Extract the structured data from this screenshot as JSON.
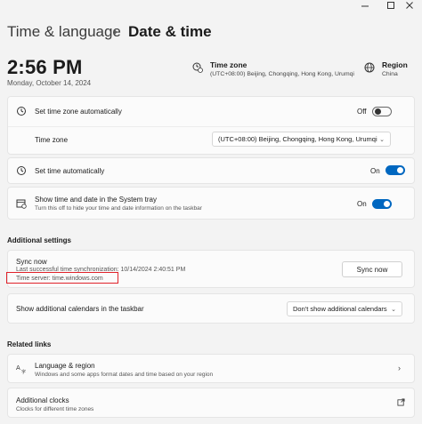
{
  "header": {
    "parent": "Time & language",
    "separator": "›",
    "title": "Date & time"
  },
  "clock": {
    "time": "2:56 PM",
    "date": "Monday, October 14, 2024"
  },
  "timezone_info": {
    "title": "Time zone",
    "value": "(UTC+08:00) Beijing, Chongqing, Hong Kong, Urumqi"
  },
  "region_info": {
    "title": "Region",
    "value": "China"
  },
  "settings": {
    "auto_timezone": {
      "label": "Set time zone automatically",
      "state": "Off"
    },
    "time_zone": {
      "label": "Time zone",
      "value": "(UTC+08:00) Beijing, Chongqing, Hong Kong, Urumqi"
    },
    "auto_time": {
      "label": "Set time automatically",
      "state": "On"
    },
    "system_tray": {
      "label": "Show time and date in the System tray",
      "sub": "Turn this off to hide your time and date information on the taskbar",
      "state": "On"
    }
  },
  "additional": {
    "heading": "Additional settings",
    "sync_title": "Sync now",
    "sync_last": "Last successful time synchronization: 10/14/2024 2:40:51 PM",
    "time_server": "Time server: time.windows.com",
    "sync_button": "Sync now",
    "calendars_label": "Show additional calendars in the taskbar",
    "calendars_value": "Don't show additional calendars"
  },
  "related": {
    "heading": "Related links",
    "language_title": "Language & region",
    "language_sub": "Windows and some apps format dates and time based on your region",
    "clocks_title": "Additional clocks",
    "clocks_sub": "Clocks for different time zones"
  },
  "colors": {
    "accent": "#0067c0",
    "highlight_box": "#e0222a",
    "background": "#f3f3f3",
    "card": "#fbfbfb"
  },
  "icons": {
    "minimize": "minimize-icon",
    "maximize": "maximize-icon",
    "close": "close-icon",
    "timezone": "clock-globe-icon",
    "region": "globe-icon",
    "auto_timezone": "clock-sync-icon",
    "auto_time": "clock-icon",
    "system_tray": "calendar-clock-icon",
    "language": "language-icon",
    "clocks": "external-link-icon"
  }
}
